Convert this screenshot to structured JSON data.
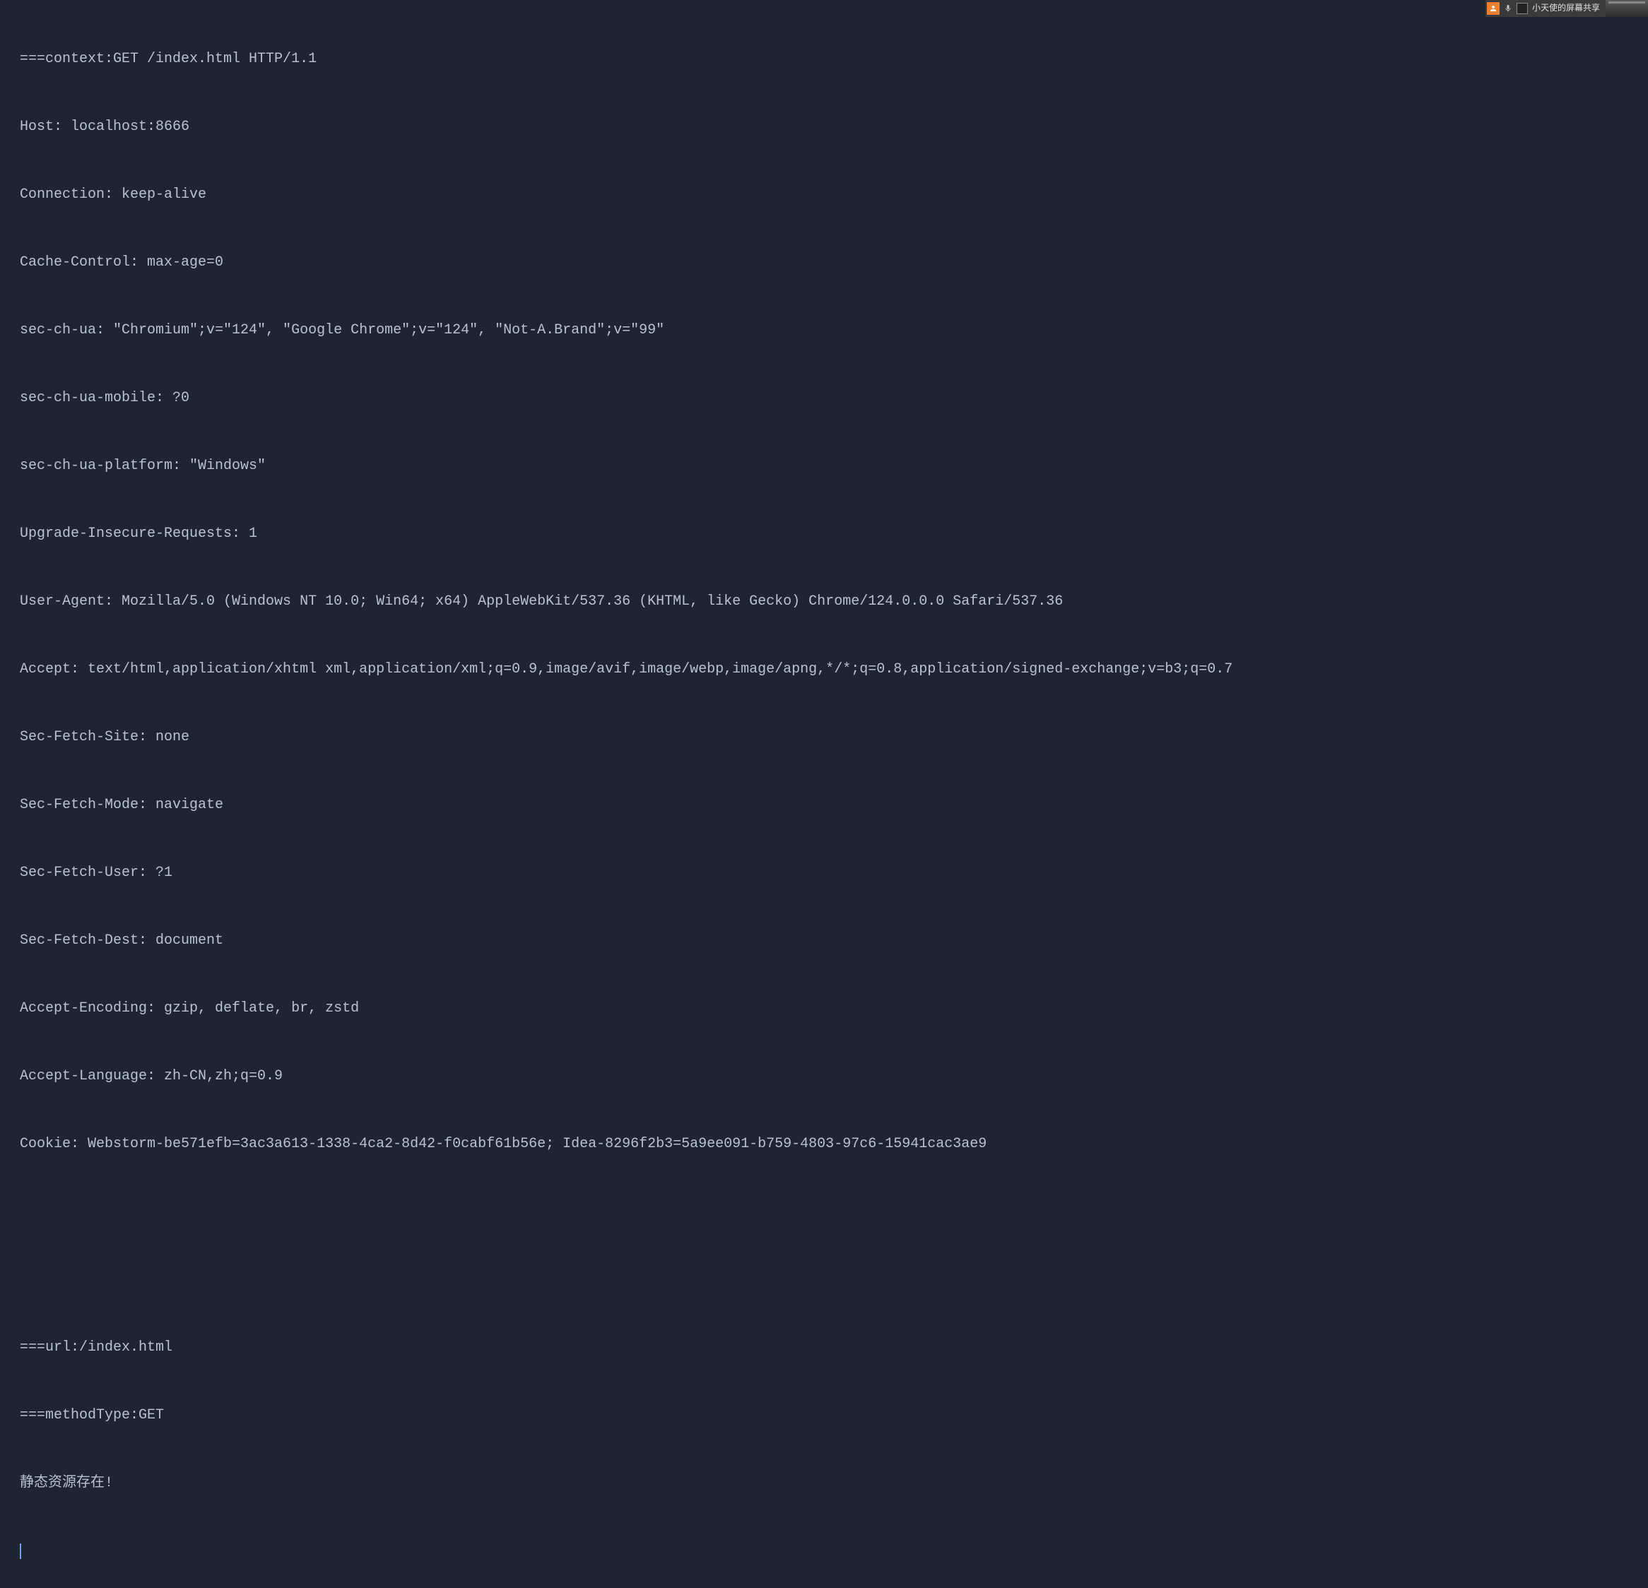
{
  "share_widget": {
    "label": "小天使的屏幕共享"
  },
  "lines": [
    "===context:GET /index.html HTTP/1.1",
    "Host: localhost:8666",
    "Connection: keep-alive",
    "Cache-Control: max-age=0",
    "sec-ch-ua: \"Chromium\";v=\"124\", \"Google Chrome\";v=\"124\", \"Not-A.Brand\";v=\"99\"",
    "sec-ch-ua-mobile: ?0",
    "sec-ch-ua-platform: \"Windows\"",
    "Upgrade-Insecure-Requests: 1",
    "User-Agent: Mozilla/5.0 (Windows NT 10.0; Win64; x64) AppleWebKit/537.36 (KHTML, like Gecko) Chrome/124.0.0.0 Safari/537.36",
    "Accept: text/html,application/xhtml xml,application/xml;q=0.9,image/avif,image/webp,image/apng,*/*;q=0.8,application/signed-exchange;v=b3;q=0.7",
    "Sec-Fetch-Site: none",
    "Sec-Fetch-Mode: navigate",
    "Sec-Fetch-User: ?1",
    "Sec-Fetch-Dest: document",
    "Accept-Encoding: gzip, deflate, br, zstd",
    "Accept-Language: zh-CN,zh;q=0.9",
    "Cookie: Webstorm-be571efb=3ac3a613-1338-4ca2-8d42-f0cabf61b56e; Idea-8296f2b3=5a9ee091-b759-4803-97c6-15941cac3ae9",
    "",
    "",
    "===url:/index.html",
    "===methodType:GET",
    "静态资源存在!"
  ]
}
